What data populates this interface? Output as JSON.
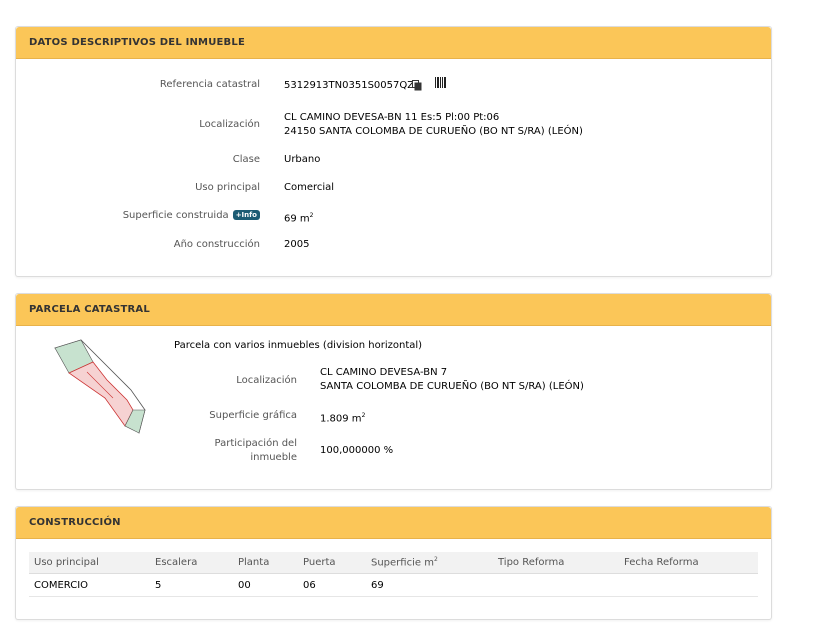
{
  "descriptivos": {
    "title": "DATOS DESCRIPTIVOS DEL INMUEBLE",
    "ref_label": "Referencia catastral",
    "ref_value": "5312913TN0351S0057QZ",
    "loc_label": "Localización",
    "loc_line1": "CL CAMINO DEVESA-BN 11 Es:5 Pl:00 Pt:06",
    "loc_line2": "24150 SANTA COLOMBA DE CURUEÑO (BO NT S/RA) (LEÓN)",
    "clase_label": "Clase",
    "clase_value": "Urbano",
    "uso_label": "Uso principal",
    "uso_value": "Comercial",
    "sup_label": "Superficie construida",
    "info_badge": "+Info",
    "sup_value": "69 m",
    "sup_unit_sup": "2",
    "anio_label": "Año construcción",
    "anio_value": "2005"
  },
  "parcela": {
    "title": "PARCELA CATASTRAL",
    "heading": "Parcela con varios inmuebles (division horizontal)",
    "loc_label": "Localización",
    "loc_line1": "CL CAMINO DEVESA-BN 7",
    "loc_line2": "SANTA COLOMBA DE CURUEÑO (BO NT S/RA) (LEÓN)",
    "sup_label": "Superficie gráfica",
    "sup_value": "1.809 m",
    "sup_unit_sup": "2",
    "part_label_1": "Participación del",
    "part_label_2": "inmueble",
    "part_value": "100,000000 %"
  },
  "construccion": {
    "title": "CONSTRUCCIÓN",
    "headers": [
      "Uso principal",
      "Escalera",
      "Planta",
      "Puerta",
      "Superficie m",
      "Tipo Reforma",
      "Fecha Reforma"
    ],
    "header_sup": "2",
    "rows": [
      [
        "COMERCIO",
        "5",
        "00",
        "06",
        "69",
        "",
        ""
      ]
    ]
  },
  "icons": {
    "copy": "copy-icon",
    "barcode": "barcode-icon"
  }
}
